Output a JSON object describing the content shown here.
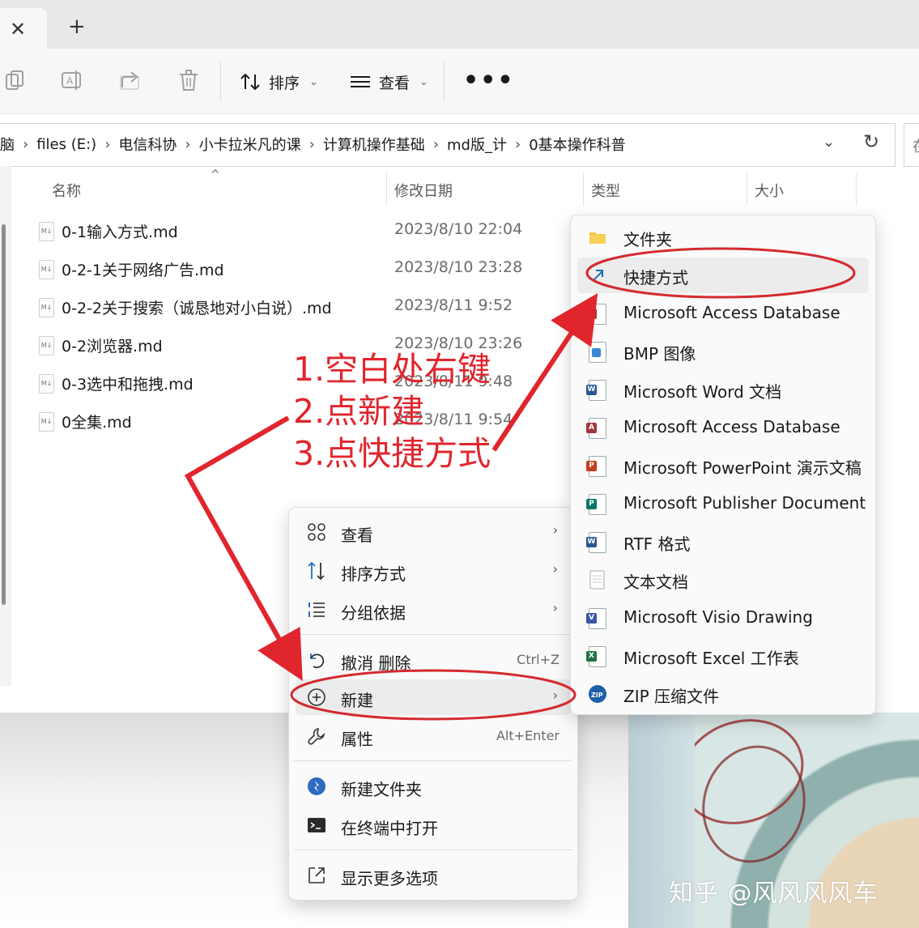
{
  "tabbar": {
    "close_glyph": "✕",
    "new_tab_glyph": "+"
  },
  "toolbar": {
    "sort_label": "排序",
    "view_label": "查看",
    "more_glyph": "•••",
    "icons": [
      "copy-icon",
      "rename-icon",
      "share-icon",
      "delete-icon",
      "sort-icon",
      "view-icon"
    ]
  },
  "address": {
    "crumbs": [
      "脑",
      "files (E:)",
      "电信科协",
      "小卡拉米凡的课",
      "计算机操作基础",
      "md版_计",
      "0基本操作科普"
    ],
    "separator": "›",
    "search_placeholder_fragment": "在"
  },
  "columns": {
    "name": "名称",
    "modified": "修改日期",
    "type": "类型",
    "size": "大小"
  },
  "files": [
    {
      "name": "0-1输入方式.md",
      "date": "2023/8/10 22:04"
    },
    {
      "name": "0-2-1关于网络广告.md",
      "date": "2023/8/10 23:28"
    },
    {
      "name": "0-2-2关于搜索（诚恳地对小白说）.md",
      "date": "2023/8/11 9:52"
    },
    {
      "name": "0-2浏览器.md",
      "date": "2023/8/10 23:26"
    },
    {
      "name": "0-3选中和拖拽.md",
      "date": "2023/8/11 9:48"
    },
    {
      "name": "0全集.md",
      "date": "2023/8/11 9:54"
    }
  ],
  "annotation": {
    "line1": "1.空白处右键",
    "line2": "2.点新建",
    "line3": "3.点快捷方式",
    "color": "#e1252d"
  },
  "context_menu": {
    "view": "查看",
    "sort_by": "排序方式",
    "group_by": "分组依据",
    "undo": "撤消 删除",
    "undo_accel": "Ctrl+Z",
    "new": "新建",
    "properties": "属性",
    "properties_accel": "Alt+Enter",
    "new_folder": "新建文件夹",
    "open_terminal": "在终端中打开",
    "more_options": "显示更多选项"
  },
  "new_submenu": [
    {
      "label": "文件夹",
      "icon": "folder-icon"
    },
    {
      "label": "快捷方式",
      "icon": "shortcut-icon"
    },
    {
      "label": "Microsoft Access Database",
      "icon": "access-icon"
    },
    {
      "label": "BMP 图像",
      "icon": "bmp-icon"
    },
    {
      "label": "Microsoft Word 文档",
      "icon": "word-icon"
    },
    {
      "label": "Microsoft Access Database",
      "icon": "access-icon"
    },
    {
      "label": "Microsoft PowerPoint 演示文稿",
      "icon": "powerpoint-icon"
    },
    {
      "label": "Microsoft Publisher Document",
      "icon": "publisher-icon"
    },
    {
      "label": "RTF 格式",
      "icon": "rtf-icon"
    },
    {
      "label": "文本文档",
      "icon": "text-document-icon"
    },
    {
      "label": "Microsoft Visio Drawing",
      "icon": "visio-icon"
    },
    {
      "label": "Microsoft Excel 工作表",
      "icon": "excel-icon"
    },
    {
      "label": "ZIP 压缩文件",
      "icon": "zip-icon"
    }
  ],
  "watermark": "知乎 @风风风风车",
  "colors": {
    "annotation_red": "#e1252d",
    "menu_bg": "#fafafa",
    "highlight_bg": "#ececec"
  }
}
